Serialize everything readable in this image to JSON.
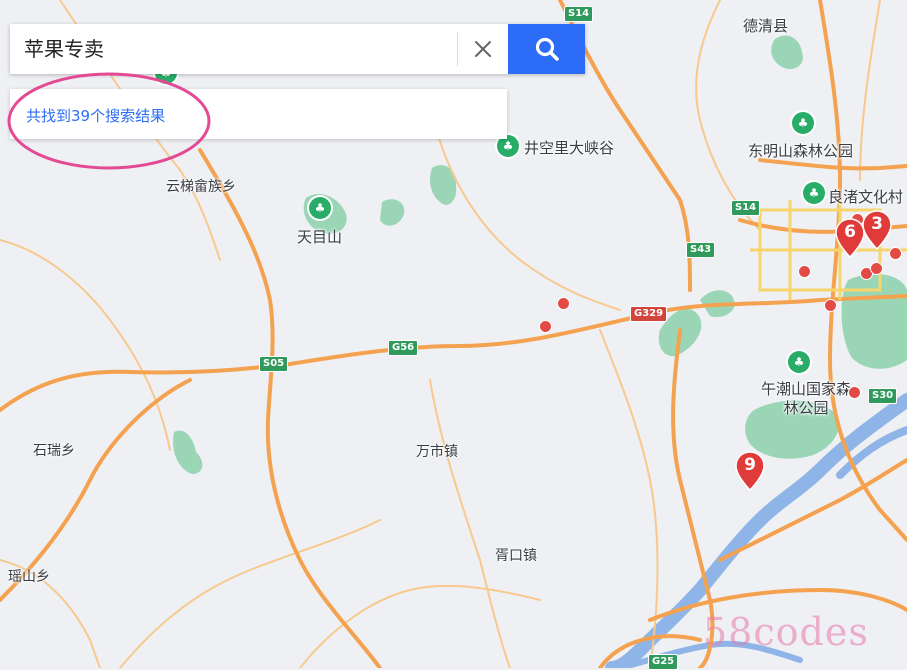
{
  "search": {
    "query": "苹果专卖",
    "result_count_text": "共找到39个搜索结果"
  },
  "places": [
    {
      "id": "deqing",
      "label": "德清县"
    },
    {
      "id": "yuntiyu",
      "label": "云梯畲族乡"
    },
    {
      "id": "tianmushan",
      "label": "天目山"
    },
    {
      "id": "jingkongli",
      "label": "井空里大峡谷"
    },
    {
      "id": "dongmingshan",
      "label": "东明山森林公园"
    },
    {
      "id": "liangzhu",
      "label": "良渚文化村"
    },
    {
      "id": "wuchaoshan",
      "label": "午潮山国家森林公园"
    },
    {
      "id": "shirui",
      "label": "石瑞乡"
    },
    {
      "id": "wanshi",
      "label": "万市镇"
    },
    {
      "id": "xukou",
      "label": "胥口镇"
    },
    {
      "id": "yaoshan",
      "label": "瑶山乡"
    }
  ],
  "road_labels": [
    "S14",
    "S14",
    "S43",
    "G329",
    "G56",
    "S05",
    "S30",
    "G25"
  ],
  "result_markers": [
    "6",
    "3",
    "9"
  ],
  "watermark": "58codes",
  "colors": {
    "search_button": "#2c6cf6",
    "result_text": "#2c6cf6",
    "highlight": "#e44a94",
    "marker": "#e03a3a",
    "poi": "#27ad68",
    "highway": "#f4a24f",
    "water": "#8fb5e8",
    "green": "#9ad6b6"
  },
  "icons": {
    "clear": "close-icon",
    "search": "search-icon",
    "poi": "tree-icon"
  }
}
